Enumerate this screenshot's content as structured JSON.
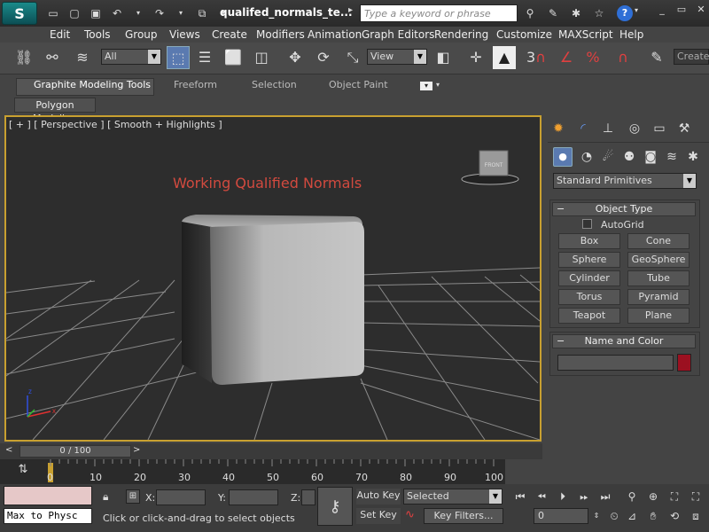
{
  "title_bar": {
    "logo_label": "S",
    "document_title": "qualifed_normals_te...",
    "search_placeholder": "Type a keyword or phrase",
    "help_label": "?"
  },
  "menu": [
    "Edit",
    "Tools",
    "Group",
    "Views",
    "Create",
    "Modifiers",
    "Animation",
    "Graph Editors",
    "Rendering",
    "Customize",
    "MAXScript",
    "Help"
  ],
  "toolbar": {
    "selection_filter": "All",
    "reference_coord": "View",
    "snap_count": "3",
    "create_selection_set": "Create"
  },
  "ribbon": {
    "tabs": [
      "Graphite Modeling Tools",
      "Freeform",
      "Selection",
      "Object Paint"
    ],
    "active_tab": "Graphite Modeling Tools",
    "panel_label": "Polygon Modeling"
  },
  "viewport": {
    "label": "[ + ] [ Perspective ] [ Smooth + Highlights ]",
    "annotation": "Working Qualified Normals",
    "viewcube_face": "FRONT",
    "axis_x": "x",
    "axis_z": "z"
  },
  "command_panel": {
    "category_dropdown": "Standard Primitives",
    "object_type_header": "Object Type",
    "autogrid_label": "AutoGrid",
    "object_buttons": [
      "Box",
      "Cone",
      "Sphere",
      "GeoSphere",
      "Cylinder",
      "Tube",
      "Torus",
      "Pyramid",
      "Teapot",
      "Plane"
    ],
    "name_color_header": "Name and Color",
    "swatch_color": "#9b1020"
  },
  "timeline": {
    "frame_display": "0 / 100",
    "ticks": [
      "0",
      "10",
      "20",
      "30",
      "40",
      "50",
      "60",
      "70",
      "80",
      "90",
      "100"
    ]
  },
  "status": {
    "maxscript_listener": "Max to Physc",
    "prompt": "Click or click-and-drag to select objects",
    "x_label": "X:",
    "y_label": "Y:",
    "z_label": "Z:",
    "auto_key": "Auto Key",
    "set_key": "Set Key",
    "key_mode": "Selected",
    "key_filters": "Key Filters...",
    "current_frame": "0"
  }
}
